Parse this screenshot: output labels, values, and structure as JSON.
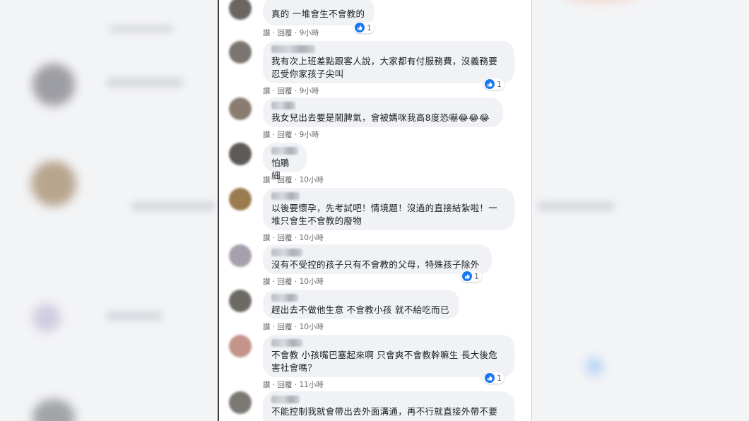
{
  "actions": {
    "read": "讚",
    "reply": "回覆",
    "sep": "·"
  },
  "colors": {
    "like": "#1877f2",
    "bubble": "#f0f2f5",
    "meta": "#65676b"
  },
  "comments": [
    {
      "text": "真的 一堆會生不會教的",
      "time": "9小時",
      "reactions": "1"
    },
    {
      "text": "我有次上班差點跟客人說，大家都有付服務費，沒義務要忍受你家孩子尖叫",
      "time": "9小時",
      "reactions": "1"
    },
    {
      "text": "我女兒出去要是鬧脾氣，會被媽咪我高8度恐嚇😂😂😂",
      "time": "9小時",
      "reactions": ""
    },
    {
      "text": "怕鵰細",
      "time": "10小時",
      "reactions": ""
    },
    {
      "text": "以後要懷孕，先考試吧！情境題！沒過的直接結紮啦！一堆只會生不會教的廢物",
      "time": "10小時",
      "reactions": ""
    },
    {
      "text": "沒有不受控的孩子只有不會教的父母，特殊孩子除外",
      "time": "10小時",
      "reactions": "1"
    },
    {
      "text": "趕出去不做他生意 不會教小孩 就不給吃而已",
      "time": "10小時",
      "reactions": ""
    },
    {
      "text": "不會教 小孩嘴巴塞起來啊 只會爽不會教幹嘛生 長大後危害社會嗎？",
      "time": "11小時",
      "reactions": "1"
    },
    {
      "text": "不能控制我就會帶出去外面溝通，再不行就直接外帶不要",
      "time": "",
      "reactions": ""
    }
  ]
}
